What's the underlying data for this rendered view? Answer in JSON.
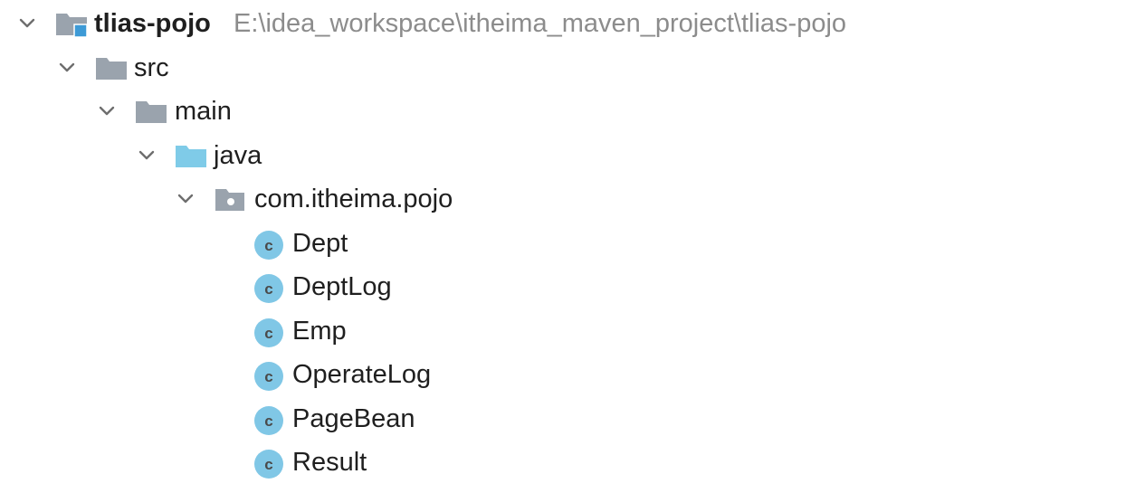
{
  "tree": {
    "root": {
      "label": "tlias-pojo",
      "path": "E:\\idea_workspace\\itheima_maven_project\\tlias-pojo",
      "icon": "module-folder-icon",
      "expanded": true
    },
    "src": {
      "label": "src",
      "icon": "folder-icon",
      "expanded": true
    },
    "main": {
      "label": "main",
      "icon": "folder-icon",
      "expanded": true
    },
    "java": {
      "label": "java",
      "icon": "source-root-folder-icon",
      "expanded": true
    },
    "package": {
      "label": "com.itheima.pojo",
      "icon": "package-folder-icon",
      "expanded": true
    },
    "classes": [
      {
        "label": "Dept",
        "icon": "class-icon"
      },
      {
        "label": "DeptLog",
        "icon": "class-icon"
      },
      {
        "label": "Emp",
        "icon": "class-icon"
      },
      {
        "label": "OperateLog",
        "icon": "class-icon"
      },
      {
        "label": "PageBean",
        "icon": "class-icon"
      },
      {
        "label": "Result",
        "icon": "class-icon"
      }
    ],
    "class_icon_glyph": "c"
  },
  "colors": {
    "folder_gray": "#9aa3ad",
    "source_root_blue": "#7fcbe8",
    "module_badge_blue": "#3d9ad6",
    "class_circle": "#80c7e6",
    "class_letter": "#4a4a4a",
    "path_text": "#8c8c8c",
    "chevron": "#6e6e6e"
  }
}
